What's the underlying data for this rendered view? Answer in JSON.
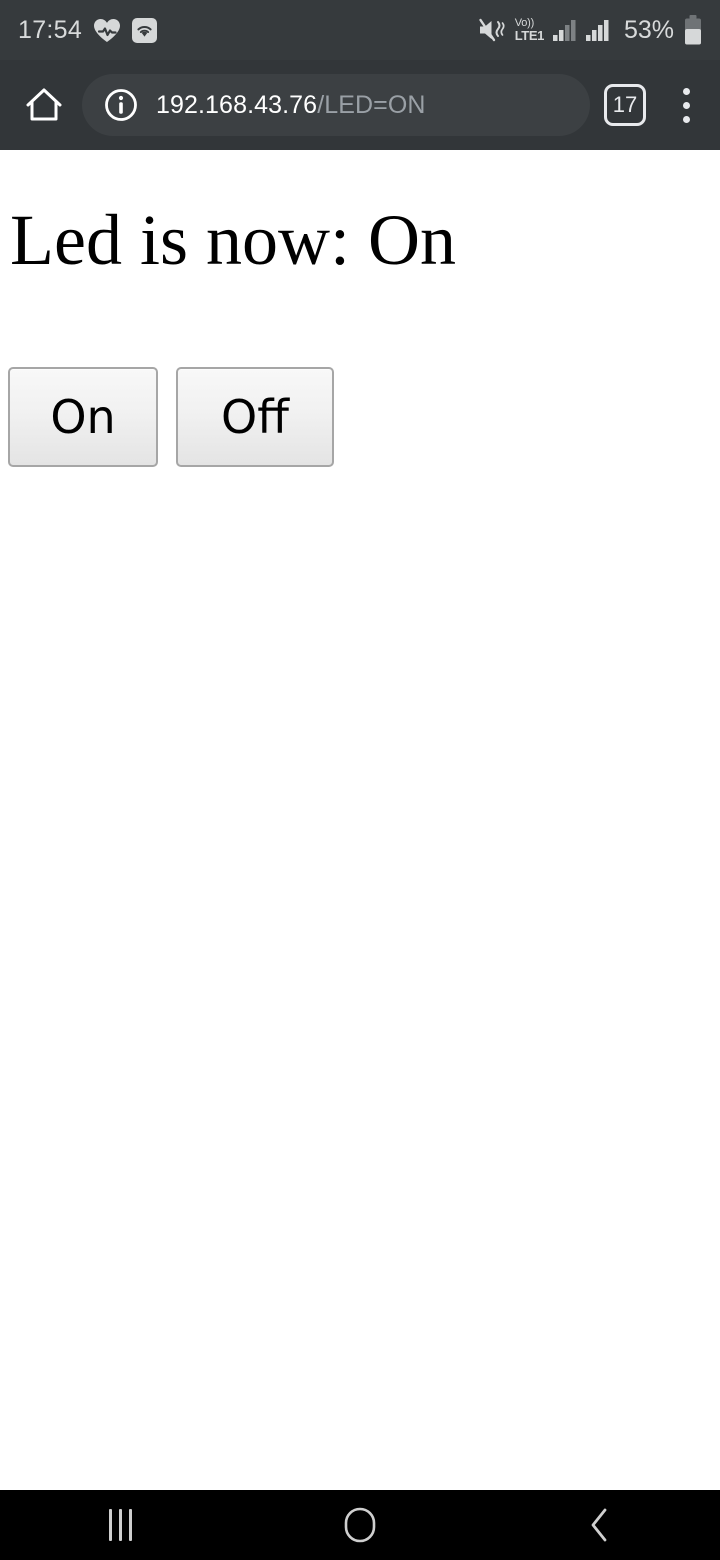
{
  "status_bar": {
    "time": "17:54",
    "battery_percent": "53%",
    "network_label_top": "Vo))",
    "network_label_bottom": "LTE1",
    "icons": [
      "heart-health-icon",
      "wifi-icon",
      "mute-vibrate-icon",
      "volte-icon",
      "signal-bars-icon-1",
      "signal-bars-icon-2",
      "battery-icon"
    ],
    "colors": {
      "background": "#363a3d",
      "foreground": "#d6d8d9"
    }
  },
  "browser": {
    "home_icon": "home-icon",
    "site_info_icon": "info-circle-icon",
    "url_host": "192.168.43.76",
    "url_path": "/LED=ON",
    "tab_count": "17",
    "menu_icon": "overflow-menu-icon",
    "colors": {
      "toolbar": "#323639",
      "urlbar": "#3c4043",
      "host_text": "#ffffff",
      "path_text": "#9aa0a6"
    }
  },
  "page": {
    "heading": "Led is now: On",
    "buttons": [
      {
        "label": "On",
        "name": "led-on-button"
      },
      {
        "label": "Off",
        "name": "led-off-button"
      }
    ],
    "colors": {
      "background": "#ffffff",
      "text": "#000000",
      "button_border": "#a6a6a6"
    }
  },
  "nav_bar": {
    "recents_icon": "recents-icon",
    "home_icon": "home-circle-icon",
    "back_icon": "back-chevron-icon",
    "colors": {
      "background": "#000000",
      "foreground": "#cfcfcf"
    }
  }
}
